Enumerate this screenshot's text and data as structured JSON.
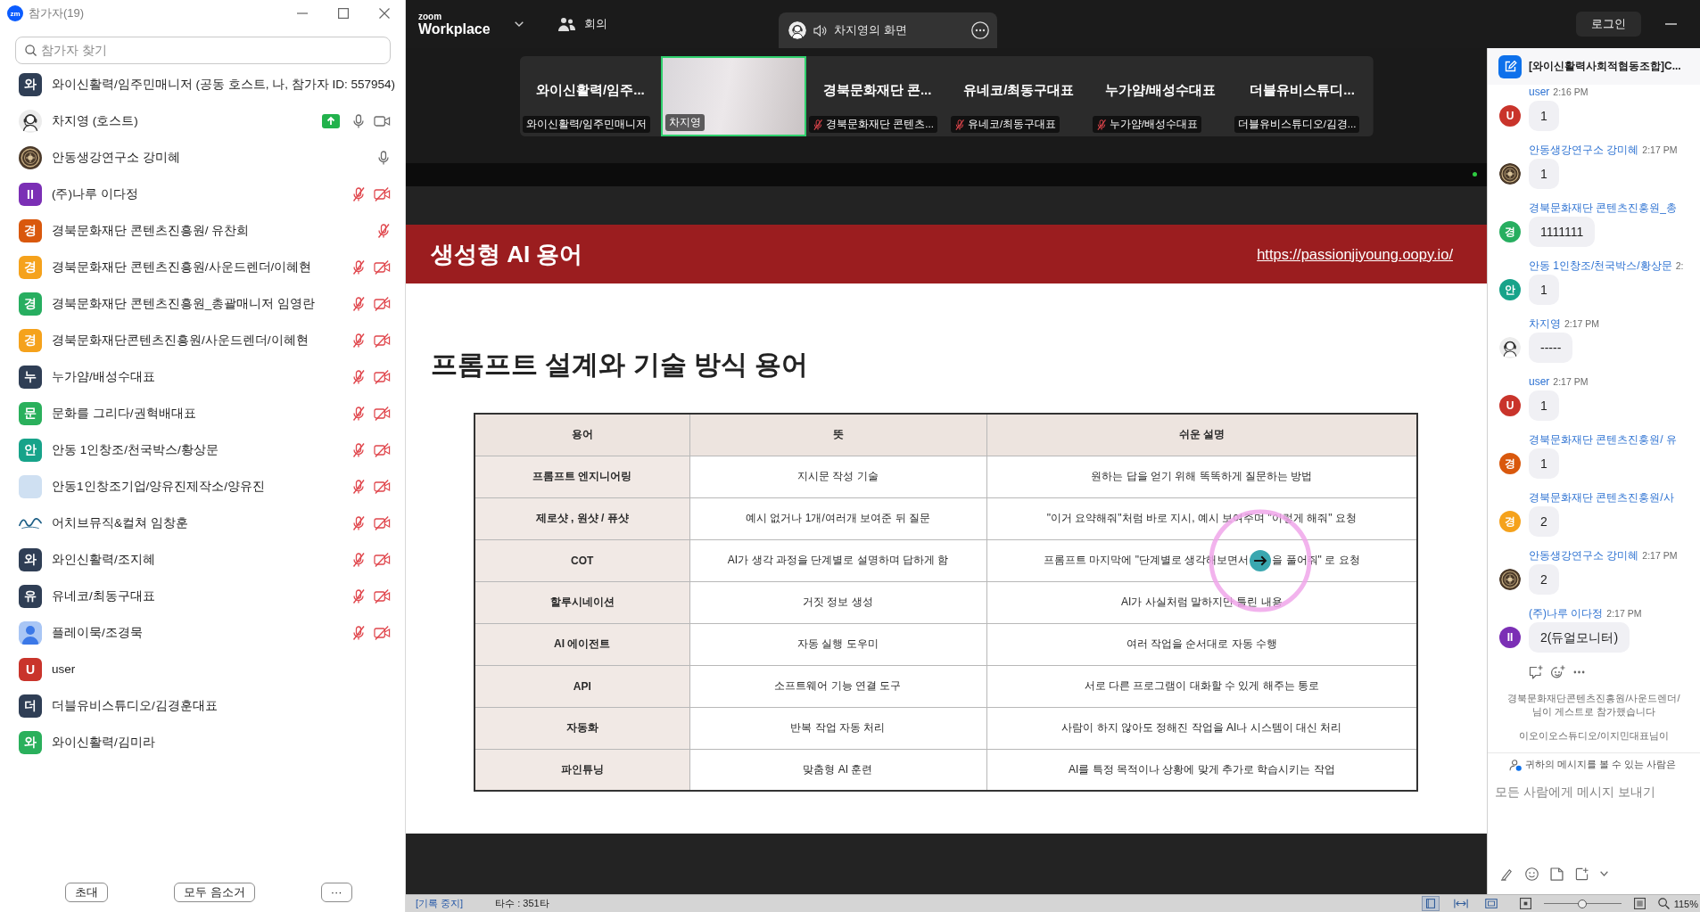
{
  "participants_panel": {
    "app_badge": "zm",
    "title": "참가자(19)",
    "search": {
      "placeholder": "참가자 찾기"
    },
    "participants": [
      {
        "name": "와이신활력/임주민매니저 (공동 호스트, 나, 참가자 ID: 557954)",
        "avatar": {
          "kind": "initial",
          "text": "와",
          "color": "#2f3e55"
        }
      },
      {
        "name": "차지영 (호스트)",
        "avatar": {
          "kind": "headset"
        },
        "status_icons": [
          {
            "kind": "share"
          },
          {
            "kind": "mic",
            "muted": false
          },
          {
            "kind": "camera",
            "on": true
          }
        ]
      },
      {
        "name": "안동생강연구소 강미혜",
        "avatar": {
          "kind": "emblem"
        },
        "status_icons": [
          {
            "kind": "mic",
            "muted": false
          }
        ]
      },
      {
        "name": "(주)나루 이다정",
        "avatar": {
          "kind": "initial",
          "text": "II",
          "color": "#7b2fb5"
        },
        "status_icons": [
          {
            "kind": "mic",
            "muted": true
          },
          {
            "kind": "camera",
            "on": false
          }
        ]
      },
      {
        "name": "경북문화재단 콘텐츠진흥원/ 유찬희",
        "avatar": {
          "kind": "initial",
          "text": "경",
          "color": "#d9580d"
        },
        "status_icons": [
          {
            "kind": "mic",
            "muted": true
          }
        ]
      },
      {
        "name": "경북문화재단 콘텐츠진흥원/사운드렌더/이혜현",
        "avatar": {
          "kind": "initial",
          "text": "경",
          "color": "#f5a21c"
        },
        "status_icons": [
          {
            "kind": "mic",
            "muted": true
          },
          {
            "kind": "camera",
            "on": false
          }
        ]
      },
      {
        "name": "경북문화재단 콘텐츠진흥원_총괄매니저 임영란",
        "avatar": {
          "kind": "initial",
          "text": "경",
          "color": "#27ae60"
        },
        "status_icons": [
          {
            "kind": "mic",
            "muted": true
          },
          {
            "kind": "camera",
            "on": false
          }
        ]
      },
      {
        "name": "경북문화재단콘텐츠진흥원/사운드렌더/이혜현",
        "avatar": {
          "kind": "initial",
          "text": "경",
          "color": "#f5a21c"
        },
        "status_icons": [
          {
            "kind": "mic",
            "muted": true
          },
          {
            "kind": "camera",
            "on": false
          }
        ]
      },
      {
        "name": "누가얌/배성수대표",
        "avatar": {
          "kind": "initial",
          "text": "누",
          "color": "#2f3e55"
        },
        "status_icons": [
          {
            "kind": "mic",
            "muted": true
          },
          {
            "kind": "camera",
            "on": false
          }
        ]
      },
      {
        "name": "문화를 그리다/권혁배대표",
        "avatar": {
          "kind": "initial",
          "text": "문",
          "color": "#2ab05c"
        },
        "status_icons": [
          {
            "kind": "mic",
            "muted": true
          },
          {
            "kind": "camera",
            "on": false
          }
        ]
      },
      {
        "name": "안동 1인창조/천국박스/황상문",
        "avatar": {
          "kind": "initial",
          "text": "안",
          "color": "#17a38a"
        },
        "status_icons": [
          {
            "kind": "mic",
            "muted": true
          },
          {
            "kind": "camera",
            "on": false
          }
        ]
      },
      {
        "name": "안동1인창조기업/양유진제작소/양유진",
        "avatar": {
          "kind": "photo"
        },
        "status_icons": [
          {
            "kind": "mic",
            "muted": true
          },
          {
            "kind": "camera",
            "on": false
          }
        ]
      },
      {
        "name": "어치브뮤직&컬쳐 임창훈",
        "avatar": {
          "kind": "script"
        },
        "status_icons": [
          {
            "kind": "mic",
            "muted": true
          },
          {
            "kind": "camera",
            "on": false
          }
        ]
      },
      {
        "name": "와인신활력/조지혜",
        "avatar": {
          "kind": "initial",
          "text": "와",
          "color": "#2f3e55"
        },
        "status_icons": [
          {
            "kind": "mic",
            "muted": true
          },
          {
            "kind": "camera",
            "on": false
          }
        ]
      },
      {
        "name": "유네코/최동구대표",
        "avatar": {
          "kind": "initial",
          "text": "유",
          "color": "#2f3e55"
        },
        "status_icons": [
          {
            "kind": "mic",
            "muted": true
          },
          {
            "kind": "camera",
            "on": false
          }
        ]
      },
      {
        "name": "플레이묵/조경묵",
        "avatar": {
          "kind": "person"
        },
        "status_icons": [
          {
            "kind": "mic",
            "muted": true
          },
          {
            "kind": "camera",
            "on": false
          }
        ]
      },
      {
        "name": "user",
        "avatar": {
          "kind": "initial",
          "text": "U",
          "color": "#c9342b"
        }
      },
      {
        "name": "더블유비스튜디오/김경훈대표",
        "avatar": {
          "kind": "initial",
          "text": "더",
          "color": "#2f3e55"
        }
      },
      {
        "name": "와이신활력/김미라",
        "avatar": {
          "kind": "initial",
          "text": "와",
          "color": "#2ab05c"
        }
      }
    ],
    "buttons": [
      "초대",
      "모두 음소거",
      "···"
    ]
  },
  "top_bar": {
    "logo_small": "zoom",
    "logo": "Workplace",
    "meeting_button": "회의",
    "share_tab": "차지영의 화면",
    "login_button": "로그인"
  },
  "thumbnails": [
    {
      "kind": "name",
      "name": "와이신활력/임주...",
      "label": "와이신활력/임주민매니저",
      "muted": false,
      "speaking": false
    },
    {
      "kind": "video",
      "label": "차지영",
      "muted": false,
      "speaking": true
    },
    {
      "kind": "name",
      "name": "경북문화재단 콘...",
      "label": "경북문화재단 콘텐츠...",
      "muted": true,
      "speaking": false
    },
    {
      "kind": "name",
      "name": "유네코/최동구대표",
      "label": "유네코/최동구대표",
      "muted": true,
      "speaking": false
    },
    {
      "kind": "name",
      "name": "누가얌/배성수대표",
      "label": "누가얌/배성수대표",
      "muted": true,
      "speaking": false
    },
    {
      "kind": "name",
      "name": "더블유비스튜디...",
      "label": "더블유비스튜디오/김경...",
      "muted": false,
      "speaking": false
    }
  ],
  "slide": {
    "title": "생성형 AI 용어",
    "link": "https://passionjiyoung.oopy.io/",
    "heading": "프롬프트 설계와 기술 방식 용어",
    "table": {
      "columns": [
        "용어",
        "뜻",
        "쉬운 설명"
      ],
      "rows": [
        [
          "프롬프트 엔지니어링",
          "지시문 작성 기술",
          "원하는 답을 얻기 위해 똑똑하게 질문하는 방법"
        ],
        [
          "제로샷 , 원샷 / 퓨샷",
          "예시 없거나 1개/여러개 보여준 뒤 질문",
          "\"이거 요약해줘\"처럼 바로 지시, 예시 보여주며 \"이렇게 해줘\" 요청"
        ],
        [
          "COT",
          "AI가 생각 과정을 단계별로 설명하며 답하게 함",
          [
            "프롬프트 마지막에 \"단계별로 생각해보면서",
            "을 풀어줘\" 로 요청"
          ]
        ],
        [
          "할루시네이션",
          "거짓 정보 생성",
          "AI가 사실처럼 말하지만 틀린 내용"
        ],
        [
          "AI 에이전트",
          "자동 실행 도우미",
          "여러 작업을 순서대로 자동 수행"
        ],
        [
          "API",
          "소프트웨어 기능 연결 도구",
          "서로 다른 프로그램이 대화할 수 있게 해주는 통로"
        ],
        [
          "자동화",
          "반복 작업 자동 처리",
          "사람이 하지 않아도 정해진 작업을 AI나 시스템이 대신 처리"
        ],
        [
          "파인튜닝",
          "맞춤형 AI 훈련",
          "AI를 특정 목적이나 상황에 맞게 추가로 학습시키는 작업"
        ]
      ]
    }
  },
  "chat": {
    "title": "[와이신활력사회적협동조합]C...",
    "messages": [
      {
        "name": "user",
        "time": "2:16 PM",
        "avatar": {
          "kind": "initial",
          "text": "U",
          "color": "#c9342b"
        },
        "text": "1"
      },
      {
        "name": "안동생강연구소 강미혜",
        "time": "2:17 PM",
        "avatar": {
          "kind": "emblem"
        },
        "text": "1"
      },
      {
        "name": "경북문화재단 콘텐츠진흥원_총",
        "avatar": {
          "kind": "initial",
          "text": "경",
          "color": "#27ae60"
        },
        "text": "1111111"
      },
      {
        "name": "안동 1인창조/천국박스/황상문",
        "time": "2:",
        "avatar": {
          "kind": "initial",
          "text": "안",
          "color": "#17a38a"
        },
        "text": "1"
      },
      {
        "name": "차지영",
        "time": "2:17 PM",
        "avatar": {
          "kind": "headset"
        },
        "text": "-----"
      },
      {
        "name": "user",
        "time": "2:17 PM",
        "avatar": {
          "kind": "initial",
          "text": "U",
          "color": "#c9342b"
        },
        "text": "1"
      },
      {
        "name": "경북문화재단 콘텐츠진흥원/ 유",
        "avatar": {
          "kind": "initial",
          "text": "경",
          "color": "#d9580d"
        },
        "text": "1"
      },
      {
        "name": "경북문화재단 콘텐츠진흥원/사",
        "avatar": {
          "kind": "initial",
          "text": "경",
          "color": "#f5a21c"
        },
        "text": "2"
      },
      {
        "name": "안동생강연구소 강미혜",
        "time": "2:17 PM",
        "avatar": {
          "kind": "emblem"
        },
        "text": "2"
      },
      {
        "name": "(주)나루 이다정",
        "time": "2:17 PM",
        "avatar": {
          "kind": "initial",
          "text": "II",
          "color": "#7b2fb5"
        },
        "text": "2(듀얼모니터)"
      }
    ],
    "system_notes": [
      "경북문화재단콘텐츠진흥원/사운드렌더/",
      "님이 게스트로 참가했습니다",
      "이오이오스튜디오/이지민대표님이"
    ],
    "visibility_note": "귀하의 메시지를 볼 수 있는 사람은",
    "input": {
      "placeholder": "모든 사람에게 메시지 보내기"
    }
  },
  "status_bar": {
    "record": "[기록 중지]",
    "typing_count": "타수 : 351타",
    "view_modes": [
      {
        "kind": "page",
        "selected": true
      },
      {
        "kind": "width",
        "selected": false
      },
      {
        "kind": "full",
        "selected": false
      }
    ],
    "zoom": {
      "level": 0.5
    },
    "zoom_value": "115%"
  }
}
